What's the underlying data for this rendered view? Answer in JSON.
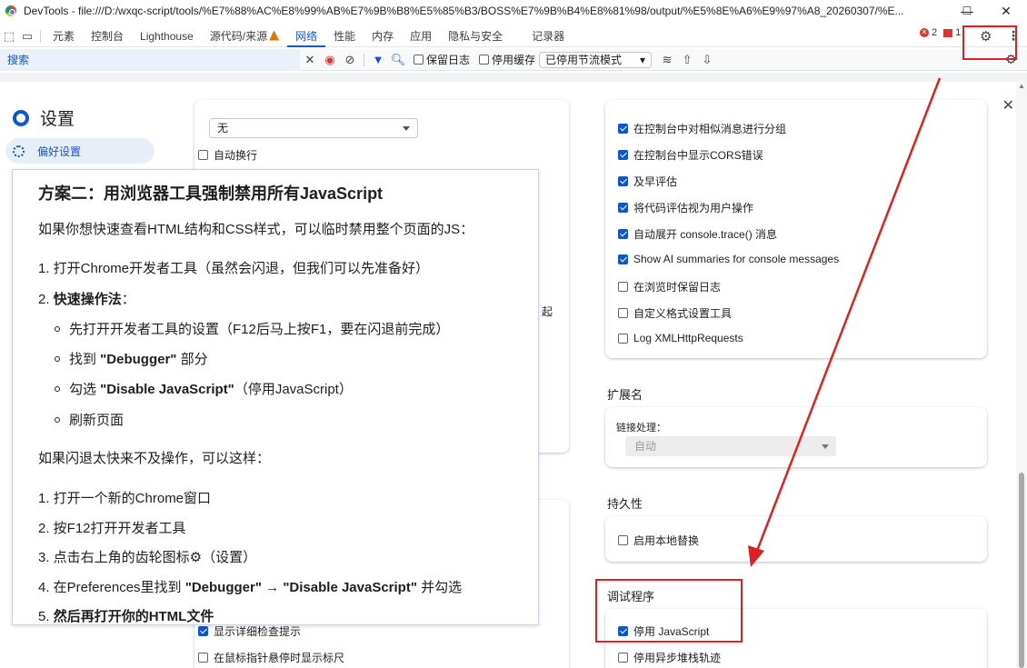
{
  "window": {
    "title": "DevTools - file:///D:/wxqc-script/tools/%E7%88%AC%E8%99%AB%E7%9B%B8%E5%85%B3/BOSS%E7%9B%B4%E8%81%98/output/%E5%8E%A6%E9%97%A8_20260307/%E...",
    "minimize": "—",
    "maximize": "☐",
    "close": "✕"
  },
  "tabs": {
    "elements": "元素",
    "console": "控制台",
    "lighthouse": "Lighthouse",
    "sources": "源代码/来源",
    "network": "网络",
    "performance": "性能",
    "memory": "内存",
    "application": "应用",
    "privacy": "隐私与安全",
    "recorder": "记录器",
    "error_count": "2",
    "message_count": "1"
  },
  "network_toolbar": {
    "search": "搜索",
    "preserve_log": "保留日志",
    "disable_cache": "停用缓存",
    "throttling": "已停用节流模式"
  },
  "settings": {
    "title": "设置",
    "nav_preferences": "偏好设置",
    "left": {
      "select_value": "无",
      "wrap": "自动换行",
      "truncated_char": "起",
      "detailed_inspect": "显示详细检查提示",
      "show_rulers": "在鼠标指针悬停时显示标尺"
    },
    "right": {
      "group_similar": "在控制台中对相似消息进行分组",
      "show_cors": "在控制台中显示CORS错误",
      "eager_eval": "及早评估",
      "treat_as_user": "将代码评估视为用户操作",
      "expand_trace": "自动展开 console.trace() 消息",
      "ai_summaries": "Show AI summaries for console messages",
      "preserve_on_nav": "在浏览时保留日志",
      "custom_formatters": "自定义格式设置工具",
      "log_xhr": "Log XMLHttpRequests",
      "extensions_header": "扩展名",
      "link_handling_label": "链接处理：",
      "link_handling_value": "自动",
      "persistence_header": "持久性",
      "local_overrides": "启用本地替换",
      "debugger_header": "调试程序",
      "disable_js": "停用 JavaScript",
      "disable_async": "停用异步堆栈轨迹"
    }
  },
  "tutorial": {
    "heading": "方案二：用浏览器工具强制禁用所有JavaScript",
    "intro": "如果你想快速查看HTML结构和CSS样式，可以临时禁用整个页面的JS：",
    "step1": "1. 打开Chrome开发者工具（虽然会闪退，但我们可以先准备好）",
    "step2_prefix": "2. ",
    "step2_bold": "快速操作法",
    "step2_suffix": "：",
    "b1": "先打开开发者工具的设置（F12后马上按F1，要在闪退前完成）",
    "b2_prefix": "找到 ",
    "b2_bold": "\"Debugger\"",
    "b2_suffix": " 部分",
    "b3_prefix": "勾选 ",
    "b3_bold": "\"Disable JavaScript\"",
    "b3_suffix": "（停用JavaScript）",
    "b4": "刷新页面",
    "fallback": "如果闪退太快来不及操作，可以这样：",
    "s1": "1. 打开一个新的Chrome窗口",
    "s2": "2. 按F12打开开发者工具",
    "s3": "3. 点击右上角的齿轮图标⚙（设置）",
    "s4_prefix": "4. 在Preferences里找到 ",
    "s4_bold1": "\"Debugger\"",
    "s4_arrow": " → ",
    "s4_bold2": "\"Disable JavaScript\"",
    "s4_suffix": " 并勾选",
    "s5_prefix": "5. ",
    "s5_bold": "然后再打开你的HTML文件"
  },
  "colors": {
    "accent": "#0b57d0",
    "annotation": "#e02020"
  }
}
